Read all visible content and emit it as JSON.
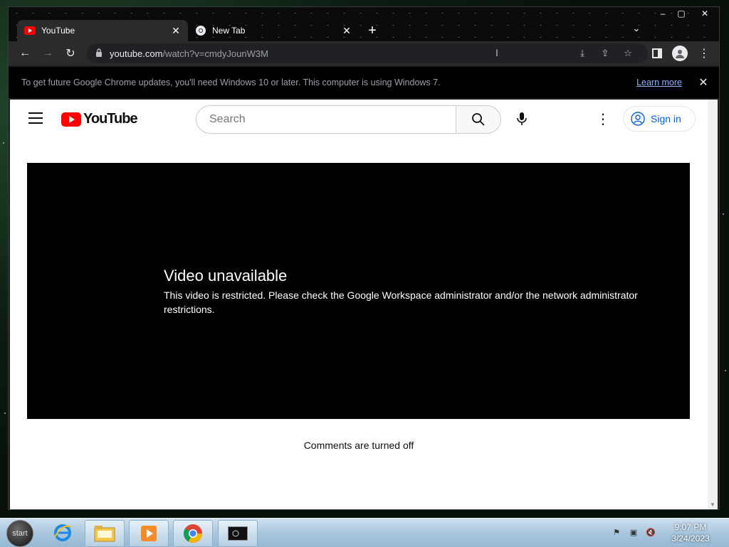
{
  "browser": {
    "tabs": [
      {
        "title": "YouTube",
        "active": true,
        "icon": "youtube-favicon"
      },
      {
        "title": "New Tab",
        "active": false,
        "icon": "chrome-favicon"
      }
    ],
    "address": {
      "host": "youtube.com",
      "path": "/watch?v=cmdyJounW3M"
    },
    "infobar": {
      "message": "To get future Google Chrome updates, you'll need Windows 10 or later. This computer is using Windows 7.",
      "link": "Learn more"
    }
  },
  "youtube": {
    "logo_text": "YouTube",
    "search_placeholder": "Search",
    "sign_in": "Sign in",
    "player": {
      "title": "Video unavailable",
      "message": "This video is restricted. Please check the Google Workspace administrator and/or the network administrator restrictions."
    },
    "comments": "Comments are turned off"
  },
  "taskbar": {
    "start_label": "start",
    "time": "9:07 PM",
    "date": "3/24/2023"
  },
  "colors": {
    "youtube_red": "#ff0000",
    "link_blue": "#8ab4f8",
    "signin_blue": "#065fd4"
  }
}
